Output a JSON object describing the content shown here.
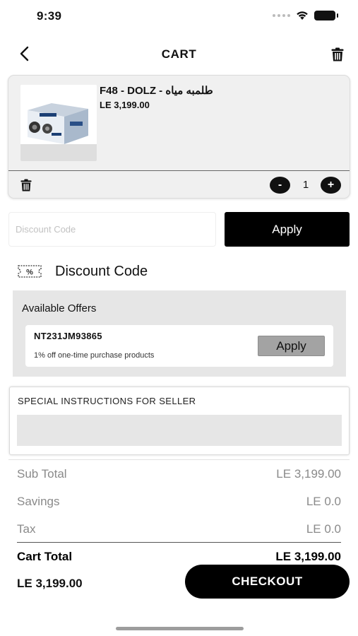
{
  "status_bar": {
    "time": "9:39"
  },
  "header": {
    "title": "CART"
  },
  "cart_item": {
    "name": "F48 - DOLZ - طلمبه مياه",
    "price": "LE 3,199.00",
    "quantity": "1",
    "decrement_label": "-",
    "increment_label": "+"
  },
  "discount": {
    "placeholder": "Discount Code",
    "apply_label": "Apply",
    "section_title": "Discount Code",
    "coupon_icon_text": "%"
  },
  "offers": {
    "title": "Available Offers",
    "items": [
      {
        "code": "NT231JM93865",
        "description": "1% off one-time purchase products",
        "apply_label": "Apply"
      }
    ]
  },
  "instructions": {
    "label": "SPECIAL INSTRUCTIONS FOR SELLER"
  },
  "totals": {
    "subtotal_label": "Sub Total",
    "subtotal_value": "LE 3,199.00",
    "savings_label": "Savings",
    "savings_value": "LE 0.0",
    "tax_label": "Tax",
    "tax_value": "LE 0.0",
    "cart_total_label": "Cart Total",
    "cart_total_value": "LE 3,199.00"
  },
  "checkout": {
    "total": "LE 3,199.00",
    "button_label": "CHECKOUT"
  },
  "icons": {
    "back": "chevron-left-icon",
    "trash": "trash-icon",
    "signal": "signal-dots-icon",
    "wifi": "wifi-icon",
    "battery": "battery-icon",
    "coupon": "coupon-icon"
  },
  "colors": {
    "primary": "#000000",
    "offer_panel": "#e6e6e6",
    "offer_apply": "#a3a3a3",
    "muted_text": "#8a8a8a"
  }
}
